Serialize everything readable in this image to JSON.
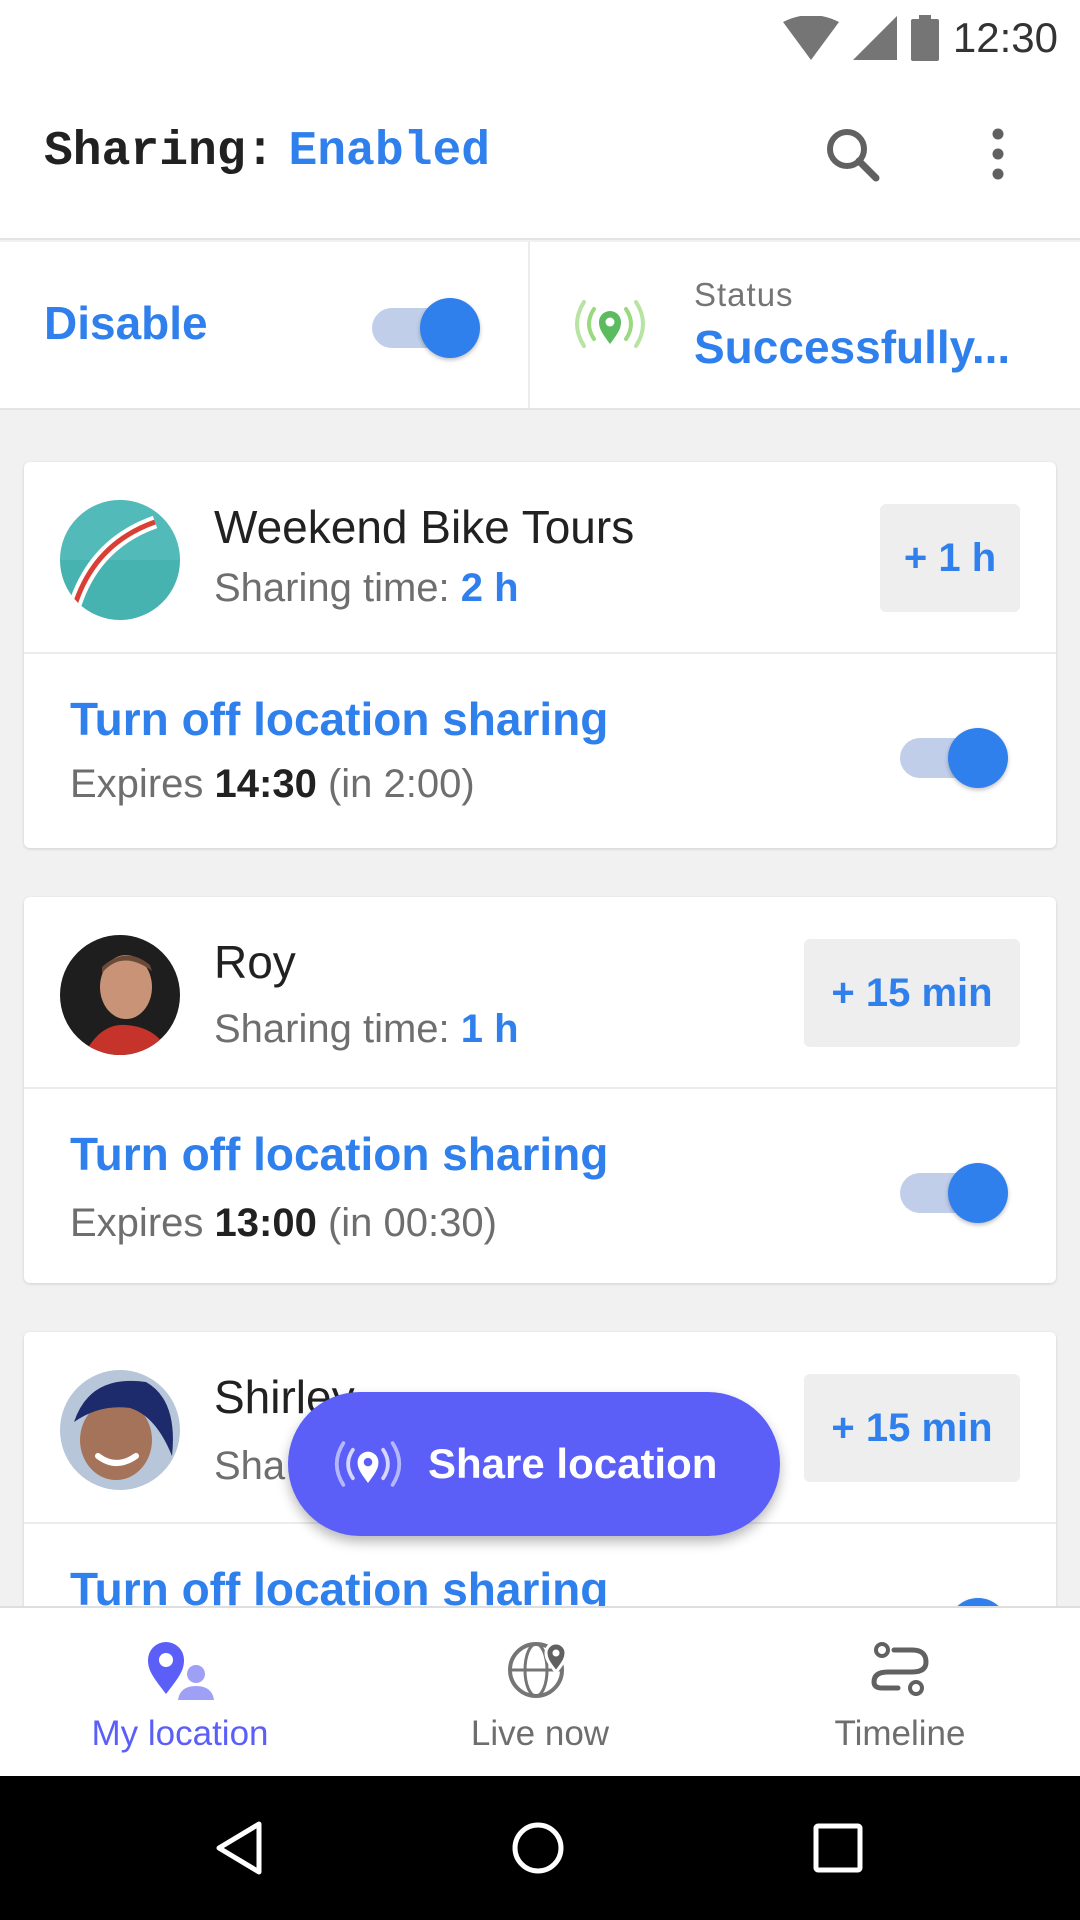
{
  "status_bar": {
    "time": "12:30"
  },
  "app_bar": {
    "title_label": "Sharing:",
    "title_value": "Enabled",
    "search_icon": "search-icon",
    "more_icon": "more-vert-icon"
  },
  "controls": {
    "disable_label": "Disable",
    "status_label": "Status",
    "status_value": "Successfully...",
    "broadcast_icon": "location-broadcast-icon"
  },
  "cards": [
    {
      "name": "Weekend Bike Tours",
      "sharing_label": "Sharing time:",
      "sharing_value": "2 h",
      "add_button": "+ 1 h",
      "action_label": "Turn off location sharing",
      "expires_label": "Expires",
      "expires_time": "14:30",
      "expires_remaining": "(in 2:00)"
    },
    {
      "name": "Roy",
      "sharing_label": "Sharing time:",
      "sharing_value": "1 h",
      "add_button": "+ 15 min",
      "action_label": "Turn off location sharing",
      "expires_label": "Expires",
      "expires_time": "13:00",
      "expires_remaining": "(in 00:30)"
    },
    {
      "name": "Shirley",
      "sharing_label": "Sha",
      "add_button": "+ 15 min",
      "action_label": "Turn off location sharing"
    }
  ],
  "fab": {
    "label": "Share location",
    "icon": "location-broadcast-icon"
  },
  "bottom_nav": [
    {
      "label": "My location",
      "icon": "person-pin-icon",
      "active": true
    },
    {
      "label": "Live now",
      "icon": "globe-pin-icon",
      "active": false
    },
    {
      "label": "Timeline",
      "icon": "timeline-route-icon",
      "active": false
    }
  ],
  "colors": {
    "accent": "#2f80ed",
    "fab": "#5b5ff7",
    "broadcast_green": "#8bd36e"
  }
}
